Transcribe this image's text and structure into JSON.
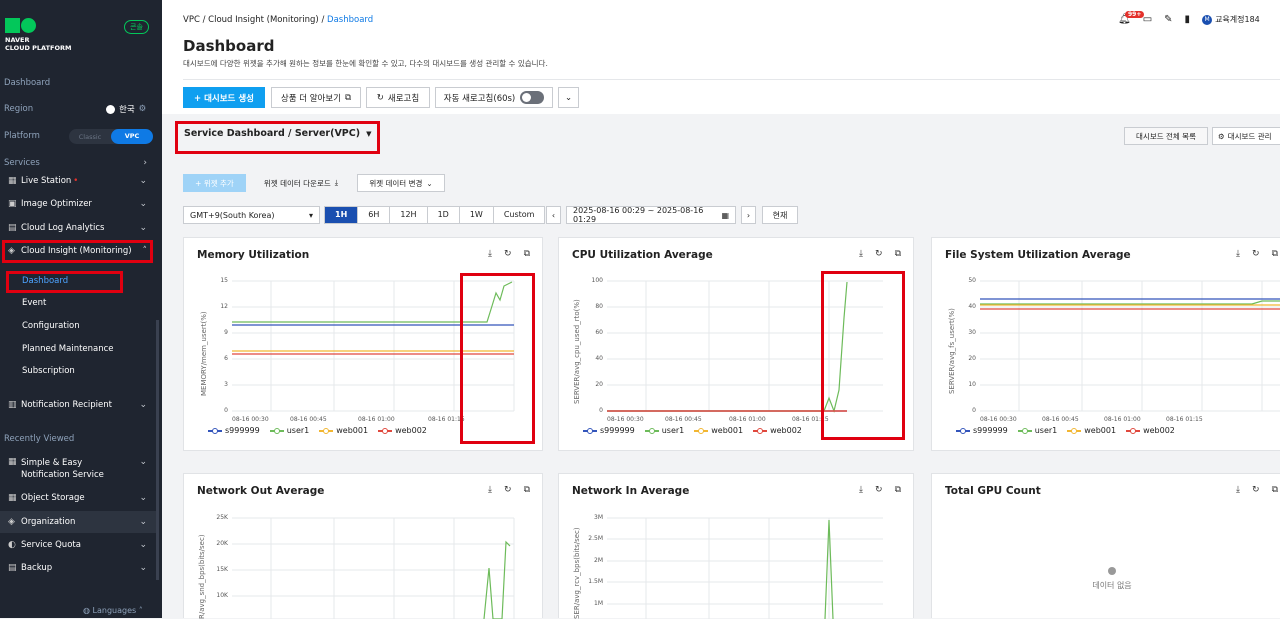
{
  "sidebar": {
    "logo_text": [
      "NAVER",
      "CLOUD PLATFORM"
    ],
    "badge": "콘솔",
    "dashboard": "Dashboard",
    "region_label": "Region",
    "region_value": "한국",
    "platform_label": "Platform",
    "platform_options": [
      "Classic",
      "VPC"
    ],
    "services_label": "Services",
    "items": [
      {
        "label": "Live Station"
      },
      {
        "label": "Image Optimizer"
      },
      {
        "label": "Cloud Log Analytics"
      },
      {
        "label": "Cloud Insight (Monitoring)"
      }
    ],
    "sub_items": [
      "Dashboard",
      "Event",
      "Configuration",
      "Planned Maintenance",
      "Subscription"
    ],
    "notification": "Notification Recipient",
    "recent_label": "Recently Viewed",
    "recent": [
      "Simple & Easy Notification Service",
      "Object Storage",
      "Organization",
      "Service Quota",
      "Backup"
    ],
    "languages": "Languages"
  },
  "header": {
    "breadcrumb": [
      "VPC",
      "Cloud Insight (Monitoring)",
      "Dashboard"
    ],
    "title": "Dashboard",
    "description": "대시보드에 다양한 위젯을 추가해 원하는 정보를 한눈에 확인할 수 있고, 다수의 대시보드를 생성 관리할 수 있습니다.",
    "notif_count": "99+",
    "user": "교육계정184",
    "user_initial": "M"
  },
  "toolbar": {
    "create": "+ 대시보드 생성",
    "learn_more": "상품 더 알아보기",
    "refresh": "새로고침",
    "auto_refresh": "자동 새로고침(60s)"
  },
  "dashboard": {
    "selected": "Service Dashboard / Server(VPC)",
    "list_all": "대시보드 전체 목록",
    "manage": "대시보드 관리",
    "add_widget": "+ 위젯 추가",
    "download": "위젯 데이터 다운로드",
    "change": "위젯 데이터 변경",
    "timezone": "GMT+9(South Korea)",
    "ranges": [
      "1H",
      "6H",
      "12H",
      "1D",
      "1W",
      "Custom"
    ],
    "date_range": "2025-08-16 00:29 ~ 2025-08-16 01:29",
    "now": "현재"
  },
  "widgets": [
    {
      "title": "Memory Utilization",
      "ylabel": "MEMORY/mem_usert(%)",
      "yticks": [
        "15",
        "12",
        "9",
        "6",
        "3",
        "0"
      ]
    },
    {
      "title": "CPU Utilization Average",
      "ylabel": "SERVER/avg_cpu_used_rto(%)",
      "yticks": [
        "100",
        "80",
        "60",
        "40",
        "20",
        "0"
      ]
    },
    {
      "title": "File System Utilization Average",
      "ylabel": "SERVER/avg_fs_usert(%)",
      "yticks": [
        "50",
        "40",
        "30",
        "20",
        "10",
        "0"
      ]
    },
    {
      "title": "Network Out Average",
      "ylabel": "R/avg_snd_bps(bits/sec)",
      "yticks": [
        "25K",
        "20K",
        "15K",
        "10K"
      ]
    },
    {
      "title": "Network In Average",
      "ylabel": "SER/avg_rcv_bps(bits/sec)",
      "yticks": [
        "3M",
        "2.5M",
        "2M",
        "1.5M",
        "1M"
      ]
    },
    {
      "title": "Total GPU Count",
      "nodata": "데이터 없음"
    }
  ],
  "xticks": [
    "08-16 00:30",
    "08-16 00:45",
    "08-16 01:00",
    "08-16 01:15"
  ],
  "legend": [
    {
      "name": "s999999",
      "color": "#3355bb"
    },
    {
      "name": "user1",
      "color": "#6dbb5a"
    },
    {
      "name": "web001",
      "color": "#f2b632"
    },
    {
      "name": "web002",
      "color": "#e0483d"
    }
  ]
}
